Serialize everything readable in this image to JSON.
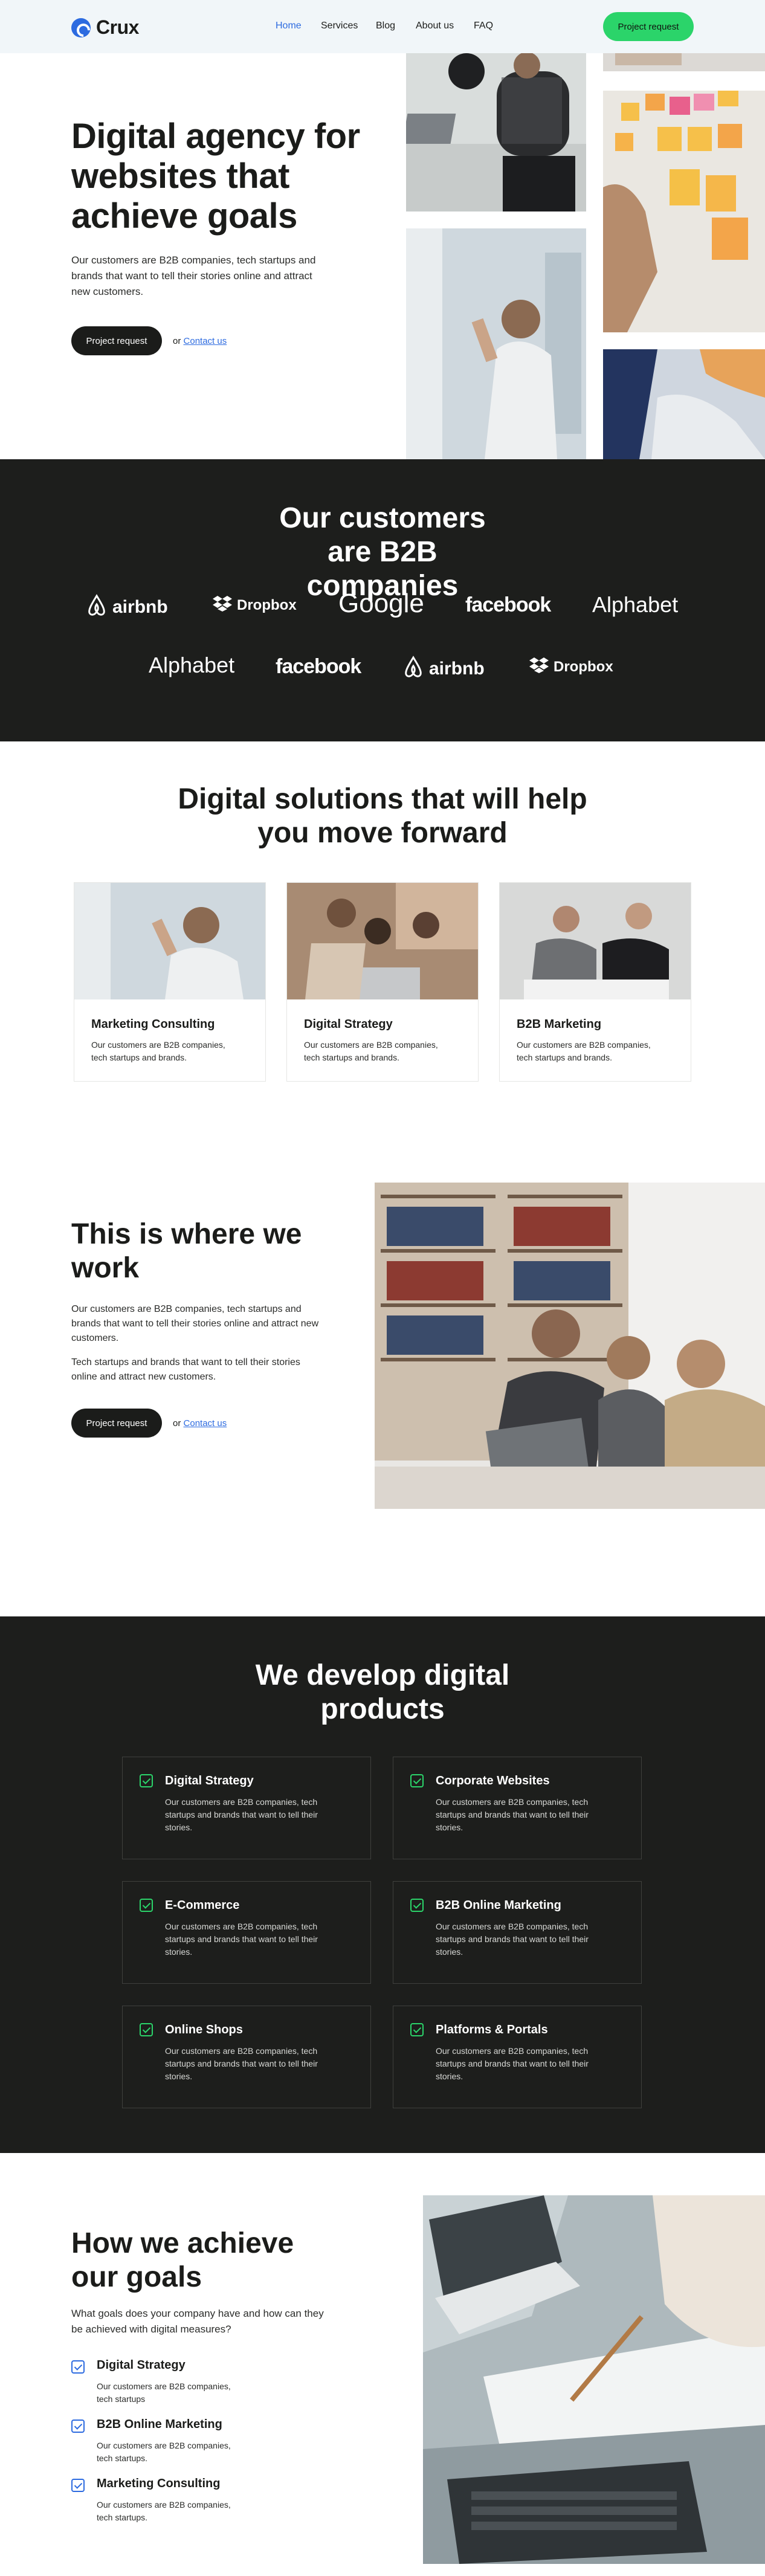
{
  "brand": {
    "name": "Crux",
    "accent": "#2d6be0",
    "cta_green": "#2bd46a",
    "dark_bg": "#1d1e1c"
  },
  "nav": {
    "items": [
      "Home",
      "Services",
      "Blog",
      "About us",
      "FAQ"
    ],
    "active": "Home",
    "cta": "Project request"
  },
  "hero": {
    "title": "Digital agency for websites that achieve goals",
    "text": "Our customers are B2B companies, tech startups and brands that want to tell their stories online and attract new customers.",
    "cta": "Project request",
    "or": "or",
    "link": "Contact us"
  },
  "customers": {
    "title": "Our customers are B2B companies",
    "logos_row1": [
      "airbnb",
      "Dropbox",
      "Google",
      "facebook",
      "Alphabet"
    ],
    "logos_row2": [
      "Alphabet",
      "facebook",
      "airbnb",
      "Dropbox"
    ]
  },
  "solutions": {
    "title": "Digital solutions that will help you move forward",
    "cards": [
      {
        "title": "Marketing Consulting",
        "text": "Our customers are B2B companies, tech startups and brands."
      },
      {
        "title": "Digital Strategy",
        "text": "Our customers are B2B companies, tech startups and brands."
      },
      {
        "title": "B2B Marketing",
        "text": "Our customers are B2B companies, tech startups and brands."
      }
    ]
  },
  "work": {
    "title": "This is where we work",
    "p1": "Our customers are B2B companies, tech startups and brands that want to tell their stories online and attract new customers.",
    "p2": "Tech startups and brands that want to tell their stories online and attract new customers.",
    "cta": "Project request",
    "or": "or",
    "link": "Contact us"
  },
  "develop": {
    "title": "We develop digital products",
    "features": [
      {
        "title": "Digital Strategy",
        "text": "Our customers are B2B companies, tech startups and brands that want to tell their stories."
      },
      {
        "title": "Corporate Websites",
        "text": "Our customers are B2B companies, tech startups and brands that want to tell their stories."
      },
      {
        "title": "E-Commerce",
        "text": "Our customers are B2B companies, tech startups and brands that want to tell their stories."
      },
      {
        "title": "B2B Online Marketing",
        "text": "Our customers are B2B companies, tech startups and brands that want to tell their stories."
      },
      {
        "title": "Online Shops",
        "text": "Our customers are B2B companies, tech startups and brands that want to tell their stories."
      },
      {
        "title": "Platforms & Portals",
        "text": "Our customers are B2B companies, tech startups and brands that want to tell their stories."
      }
    ]
  },
  "goals": {
    "title": "How we achieve our goals",
    "intro": "What goals does your company have and how can they be achieved with digital measures?",
    "items": [
      {
        "title": "Digital Strategy",
        "text": "Our customers are B2B companies, tech startups"
      },
      {
        "title": "B2B Online Marketing",
        "text": "Our customers are B2B companies, tech startups."
      },
      {
        "title": "Marketing Consulting",
        "text": "Our customers are B2B companies, tech startups."
      }
    ]
  }
}
